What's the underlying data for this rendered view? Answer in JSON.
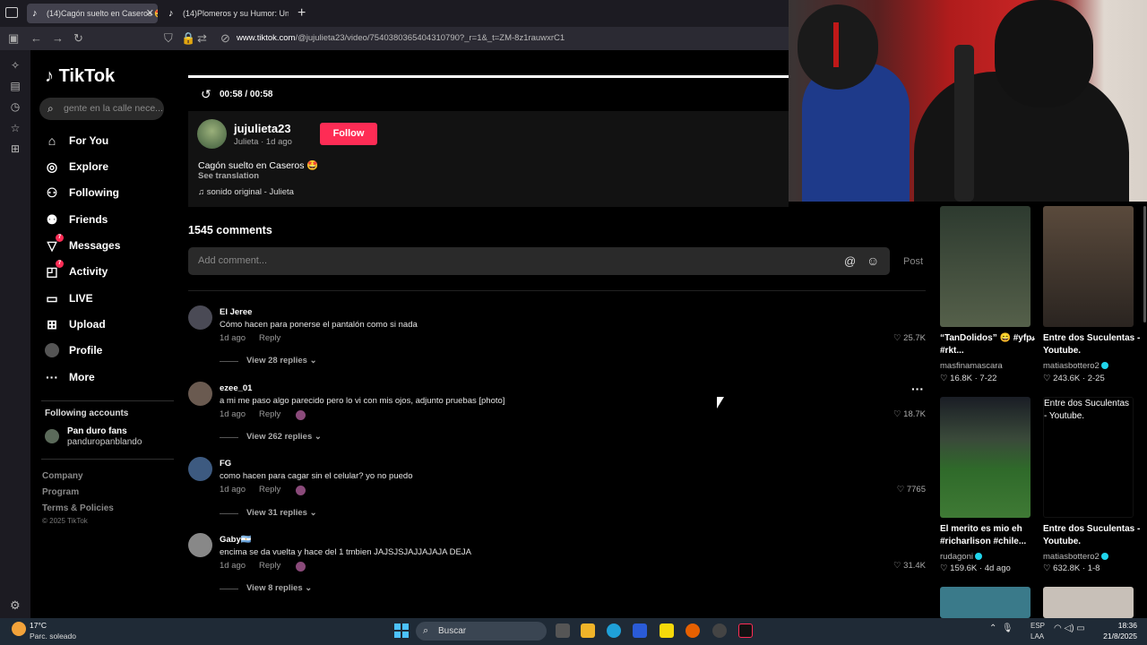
{
  "browser": {
    "tabs": [
      {
        "label": "(14)Cagón suelto en Caseros 🤩",
        "active": true
      },
      {
        "label": "(14)Plomeros y su Humor: Una",
        "active": false
      }
    ],
    "new_tab": "+",
    "url_host": "www.tiktok.com",
    "url_path": "/@jujulieta23/video/7540380365404310790?_r=1&_t=ZM-8z1rauwxrC1"
  },
  "tiktok": {
    "logo": "TikTok",
    "search_placeholder": "gente en la calle nece...",
    "nav": [
      {
        "label": "For You",
        "icon": "home-icon"
      },
      {
        "label": "Explore",
        "icon": "compass-icon"
      },
      {
        "label": "Following",
        "icon": "following-icon"
      },
      {
        "label": "Friends",
        "icon": "friends-icon"
      },
      {
        "label": "Messages",
        "icon": "messages-icon",
        "badge": "7"
      },
      {
        "label": "Activity",
        "icon": "activity-icon",
        "badge": "7"
      },
      {
        "label": "LIVE",
        "icon": "live-icon"
      },
      {
        "label": "Upload",
        "icon": "upload-icon"
      },
      {
        "label": "Profile",
        "icon": "profile-icon"
      },
      {
        "label": "More",
        "icon": "more-icon"
      }
    ],
    "following_accounts": {
      "title": "Following accounts",
      "items": [
        {
          "name": "Pan duro fans",
          "handle": "panduropanblando"
        }
      ]
    },
    "footer": [
      "Company",
      "Program",
      "Terms & Policies"
    ],
    "copyright": "© 2025 TikTok"
  },
  "video": {
    "progress": 1.0,
    "time": "00:58 / 00:58",
    "author_name": "jujulieta23",
    "author_sub": "Julieta · 1d ago",
    "follow_label": "Follow",
    "caption": "Cagón suelto en Caseros 🤩",
    "see_translation": "See translation",
    "sound": "♫ sonido original - Julieta"
  },
  "comments": {
    "count": "1545 comments",
    "input_placeholder": "Add comment...",
    "post_label": "Post",
    "items": [
      {
        "name": "El Jeree",
        "text": "Cómo hacen para ponerse el pantalón como si nada",
        "time": "1d ago",
        "reply": "Reply",
        "likes": "25.7K",
        "view": "View 28 replies",
        "avatar_color": "#4a4a55"
      },
      {
        "name": "ezee_01",
        "text": "a mi me paso algo parecido pero lo vi con mis ojos, adjunto pruebas [photo]",
        "time": "1d ago",
        "reply": "Reply",
        "likes": "18.7K",
        "view": "View 262 replies",
        "avatar_color": "#6a5a50"
      },
      {
        "name": "FG",
        "text": "como hacen para cagar sin el celular? yo no puedo",
        "time": "1d ago",
        "reply": "Reply",
        "likes": "7765",
        "view": "View 31 replies",
        "avatar_color": "#3d5a80"
      },
      {
        "name": "Gaby🇦🇷",
        "text": "encima se da vuelta y hace del 1 tmbien JAJSJSJAJJAJAJA DEJA",
        "time": "1d ago",
        "reply": "Reply",
        "likes": "31.4K",
        "view": "View 8 replies",
        "avatar_color": "#888888"
      }
    ]
  },
  "recommendations": [
    {
      "title": "“TanDolidos” 😄 #yfp𝓈 #rkt...",
      "user": "masfinamascara",
      "stats": "♡ 16.8K · 7-22",
      "verified": false,
      "color": "#3a4a3a"
    },
    {
      "title": "Entre dos Suculentas - Youtube.",
      "user": "matiasbottero2",
      "stats": "♡ 243.6K · 2-25",
      "verified": true,
      "color": "#4a3a30"
    },
    {
      "title": "El merito es mio eh #richarlison #chile...",
      "user": "rudagoni",
      "stats": "♡ 159.6K · 4d ago",
      "verified": true,
      "color": "#2f5a2a"
    },
    {
      "title": "Entre dos Suculentas - Youtube.",
      "user": "matiasbottero2",
      "stats": "♡ 632.8K · 1-8",
      "verified": true,
      "color": "#000000",
      "overlay": "Entre dos Suculentas - Youtube."
    }
  ],
  "taskbar": {
    "temp": "17°C",
    "weather": "Parc. soleado",
    "search": "Buscar",
    "lang1": "ESP",
    "lang2": "LAA",
    "time": "18:36",
    "date": "21/8/2025"
  },
  "colors": {
    "accent": "#fe2c55",
    "verified": "#20d5ec"
  }
}
